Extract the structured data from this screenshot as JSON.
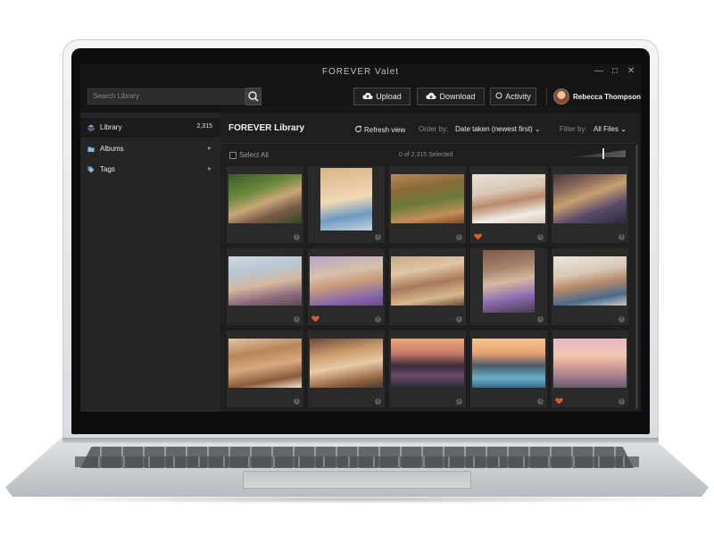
{
  "window": {
    "title": "FOREVER Valet",
    "minimize_glyph": "—",
    "maximize_glyph": "□",
    "close_glyph": "✕"
  },
  "toolbar": {
    "search_placeholder": "Search Library",
    "upload_label": "Upload",
    "download_label": "Download",
    "activity_label": "Activity",
    "user_name": "Rebecca Thompson"
  },
  "sidebar": {
    "items": [
      {
        "label": "Library",
        "count": "2,315",
        "icon": "layers-icon",
        "active": true
      },
      {
        "label": "Albums",
        "icon": "folder-icon",
        "chevron": "▸"
      },
      {
        "label": "Tags",
        "icon": "tag-icon",
        "chevron": "▸"
      }
    ]
  },
  "main": {
    "title": "FOREVER Library",
    "refresh_label": "Refresh view",
    "order_by_label": "Order by:",
    "order_by_value": "Date taken (newest first) ⌄",
    "filter_by_label": "Filter by:",
    "filter_by_value": "All Files ⌄",
    "select_all_label": "Select All",
    "selected_count": "0 of 2,315 Selected"
  },
  "colors": {
    "heart": "#e0572f",
    "accent": "#e6e6e6"
  },
  "photos": [
    {
      "subject": "children picking flowers in garden",
      "favorite": false
    },
    {
      "subject": "father and child lying down",
      "favorite": false
    },
    {
      "subject": "kids playing in autumn forest",
      "favorite": false
    },
    {
      "subject": "mother and baby on bed",
      "favorite": true
    },
    {
      "subject": "lavender field at sunset",
      "favorite": false
    },
    {
      "subject": "couple hugging outdoors",
      "favorite": false
    },
    {
      "subject": "family in lavender field",
      "favorite": true
    },
    {
      "subject": "mother and daughter baking",
      "favorite": false
    },
    {
      "subject": "mother holding child",
      "favorite": false
    },
    {
      "subject": "family hugging at home",
      "favorite": false
    },
    {
      "subject": "mother and daughter laughing",
      "favorite": false
    },
    {
      "subject": "family at dinner table",
      "favorite": false
    },
    {
      "subject": "palm trees at sunset",
      "favorite": false
    },
    {
      "subject": "children in pool at sunset",
      "favorite": false
    },
    {
      "subject": "family on beach at sunset",
      "favorite": true
    }
  ]
}
